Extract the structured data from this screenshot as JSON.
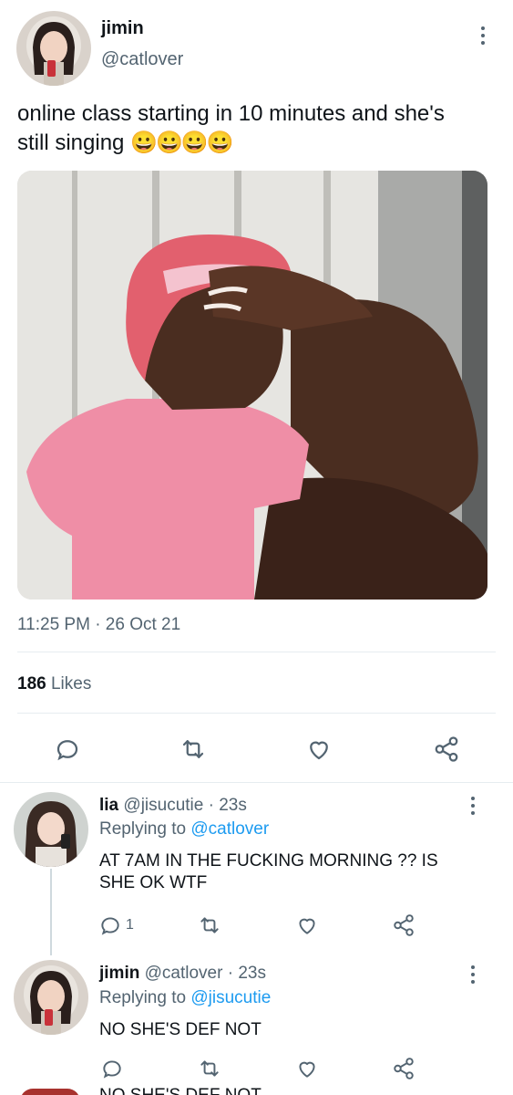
{
  "tweet": {
    "author_name": "jimin",
    "author_handle": "@catlover",
    "text_line1": "online class starting in 10 minutes and she's",
    "text_line2": "still singing",
    "emoji": "😀😀😀😀",
    "timestamp": "11:25 PM · 26 Oct 21",
    "likes_count": "186",
    "likes_label": "Likes"
  },
  "replies": [
    {
      "name": "lia",
      "handle": "@jisucutie",
      "time": "· 23s",
      "replying_label": "Replying to",
      "replying_to": "@catlover",
      "text": "AT 7AM IN THE FUCKING MORNING ?? IS SHE OK WTF",
      "reply_count": "1"
    },
    {
      "name": "jimin",
      "handle": "@catlover",
      "time": "· 23s",
      "replying_label": "Replying to",
      "replying_to": "@jisucutie",
      "text": "NO SHE'S DEF NOT",
      "reply_count": ""
    }
  ],
  "cut_off_text": "NO SHE'S DEF NOT",
  "icons": [
    "more-icon",
    "reply-icon",
    "retweet-icon",
    "like-icon",
    "share-icon"
  ],
  "colors": {
    "accent": "#1d9bf0",
    "muted": "#536471",
    "divider": "#e6ecf0"
  }
}
